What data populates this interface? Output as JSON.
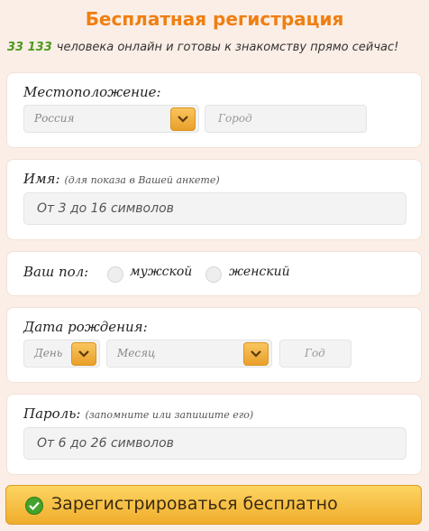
{
  "header": {
    "title": "Бесплатная регистрация",
    "online_count": "33 133",
    "online_text": "человека онлайн и готовы к знакомству прямо сейчас!"
  },
  "location": {
    "label": "Местоположение:",
    "country_value": "Россия",
    "city_placeholder": "Город"
  },
  "name": {
    "label": "Имя:",
    "hint": "(для показа в Вашей анкете)",
    "placeholder": "От 3 до 16 символов"
  },
  "gender": {
    "label": "Ваш пол:",
    "options": [
      "мужской",
      "женский"
    ]
  },
  "birthdate": {
    "label": "Дата рождения:",
    "day": "День",
    "month": "Месяц",
    "year": "Год"
  },
  "password": {
    "label": "Пароль:",
    "hint": "(запомните или запишите его)",
    "placeholder": "От 6 до 26 символов"
  },
  "submit": {
    "label": "Зарегистрироваться бесплатно"
  },
  "colors": {
    "accent": "#ef7f12",
    "count": "#4d9a1c",
    "button": "#f0ad2d"
  },
  "icons": {
    "dropdown": "chevron-down-icon",
    "submit": "check-circle-icon"
  }
}
